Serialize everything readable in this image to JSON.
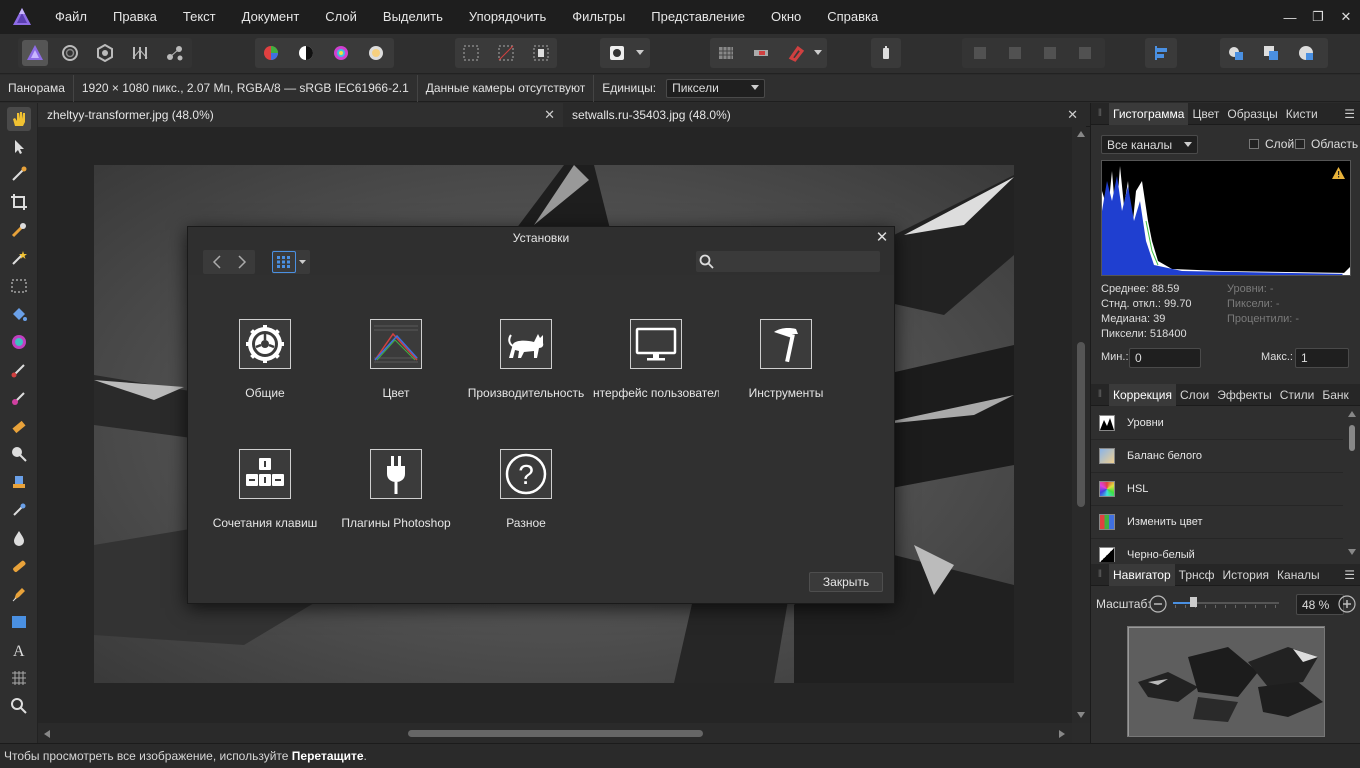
{
  "menubar": {
    "logo_icon": "affinity-photo-logo-icon",
    "items": [
      "Файл",
      "Правка",
      "Текст",
      "Документ",
      "Слой",
      "Выделить",
      "Упорядочить",
      "Фильтры",
      "Представление",
      "Окно",
      "Справка"
    ]
  },
  "context": {
    "mode": "Панорама",
    "info": "1920 × 1080 пикс., 2.07 Мп, RGBA/8 — sRGB IEC61966-2.1",
    "camera": "Данные камеры отсутствуют",
    "units_label": "Единицы:",
    "units_value": "Пиксели"
  },
  "tabs": [
    {
      "label": "zheltyy-transformer.jpg (48.0%)"
    },
    {
      "label": "setwalls.ru-35403.jpg (48.0%)"
    }
  ],
  "dialog": {
    "title": "Установки",
    "search_placeholder": "",
    "items": [
      {
        "label": "Общие",
        "icon": "gear-icon"
      },
      {
        "label": "Цвет",
        "icon": "color-curve-icon"
      },
      {
        "label": "Производительность",
        "icon": "cat-icon"
      },
      {
        "label": "нтерфейс пользовател",
        "icon": "monitor-icon"
      },
      {
        "label": "Инструменты",
        "icon": "hammer-icon"
      },
      {
        "label": "Сочетания клавиш",
        "icon": "keyboard-shortcut-icon"
      },
      {
        "label": "Плагины Photoshop",
        "icon": "plug-icon"
      },
      {
        "label": "Разное",
        "icon": "question-icon"
      }
    ],
    "close_label": "Закрыть"
  },
  "histogram_panel": {
    "tabs": [
      "Гистограмма",
      "Цвет",
      "Образцы",
      "Кисти"
    ],
    "channel": "Все каналы",
    "layer_label": "Слой",
    "area_label": "Область",
    "stats": [
      "Среднее: 88.59",
      "Стнд. откл.: 99.70",
      "Медиана: 39",
      "Пиксели: 518400"
    ],
    "stats_dim": [
      "Уровни: -",
      "Пиксели: -",
      "Процентили: -"
    ],
    "min_label": "Мин.:",
    "min_value": "0",
    "max_label": "Макс.:",
    "max_value": "1"
  },
  "adjust_panel": {
    "tabs": [
      "Коррекция",
      "Слои",
      "Эффекты",
      "Стили",
      "Банк"
    ],
    "items": [
      "Уровни",
      "Баланс белого",
      "HSL",
      "Изменить цвет",
      "Черно-белый"
    ]
  },
  "navigator_panel": {
    "tabs": [
      "Навигатор",
      "Трнсф",
      "История",
      "Каналы"
    ],
    "zoom_label": "Масштаб:",
    "zoom_value": "48 %",
    "zoom_fraction": 0.48
  },
  "status": {
    "text": "Чтобы просмотреть все изображение, используйте ",
    "bold": "Перетащите",
    "tail": "."
  },
  "colors": {
    "accent": "#7c5bd6",
    "panel": "#2f2f2f",
    "canvas_bg": "#252525"
  }
}
